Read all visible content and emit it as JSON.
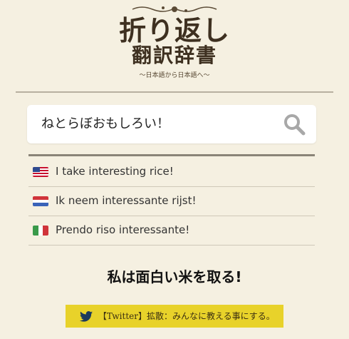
{
  "header": {
    "logo_line1": "折り返し",
    "logo_line2": "翻訳辞書",
    "logo_subtitle": "〜日本語から日本語へ〜"
  },
  "search": {
    "value": "ねとらぼおもしろい！",
    "icon": "magnifier-icon"
  },
  "results": [
    {
      "flag": "us-flag",
      "text": "I take interesting rice!"
    },
    {
      "flag": "nl-flag",
      "text": "Ik neem interessante rijst!"
    },
    {
      "flag": "it-flag",
      "text": "Prendo riso interessante!"
    }
  ],
  "answer": "私は面白い米を取る!",
  "share": {
    "icon": "twitter-bird-icon",
    "label": "【Twitter】拡散：みんなに教える事にする。",
    "color": "#e8d22a"
  },
  "colors": {
    "background": "#f5f0e1",
    "logo": "#3e3020"
  }
}
